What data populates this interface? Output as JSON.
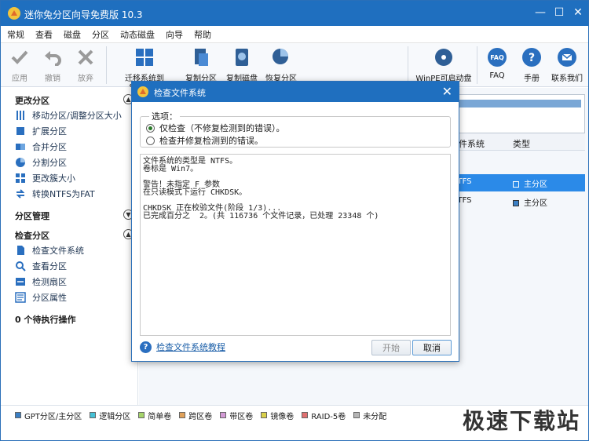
{
  "app": {
    "title": "迷你兔分区向导免费版 10.3"
  },
  "menu": [
    "常规",
    "查看",
    "磁盘",
    "分区",
    "动态磁盘",
    "向导",
    "帮助"
  ],
  "toolbar": {
    "apply": "应用",
    "undo": "撤销",
    "discard": "放弃",
    "migrate": "迁移系统到SSD/HD",
    "copy_partition": "复制分区",
    "copy_disk": "复制磁盘",
    "recover_partition": "恢复分区",
    "winpe": "WinPE可启动盘",
    "faq": "FAQ",
    "manual": "手册",
    "contact": "联系我们"
  },
  "sidebar": {
    "change_partition": "更改分区",
    "change_items": [
      "移动分区/调整分区大小",
      "扩展分区",
      "合并分区",
      "分割分区",
      "更改簇大小",
      "转换NTFS为FAT"
    ],
    "partition_management": "分区管理",
    "check_partition": "检查分区",
    "check_items": [
      "检查文件系统",
      "查看分区",
      "检测扇区",
      "分区属性"
    ],
    "pending": "0 个待执行操作"
  },
  "table": {
    "col_fs": "文件系统",
    "col_type": "类型",
    "rows": [
      {
        "fs": "NTFS",
        "type": "主分区",
        "selected": true
      },
      {
        "fs": "NTFS",
        "type": "主分区",
        "selected": false
      }
    ]
  },
  "legend": [
    {
      "label": "GPT分区/主分区",
      "color": "#3b7fc4"
    },
    {
      "label": "逻辑分区",
      "color": "#45c1d6"
    },
    {
      "label": "简单卷",
      "color": "#a5d46a"
    },
    {
      "label": "跨区卷",
      "color": "#e0a15a"
    },
    {
      "label": "带区卷",
      "color": "#d39ad6"
    },
    {
      "label": "镜像卷",
      "color": "#d9d04a"
    },
    {
      "label": "RAID-5卷",
      "color": "#e07070"
    },
    {
      "label": "未分配",
      "color": "#b5b5b5"
    }
  ],
  "watermark": "极速下载站",
  "dialog": {
    "title": "检查文件系统",
    "options_label": "选项：",
    "option1": "仅检查（不修复检测到的错误）。",
    "option2": "检查并修复检测到的错误。",
    "output": "文件系统的类型是 NTFS。\n卷标是 Win7。\n\n警告！未指定 F 参数\n在只读模式下运行 CHKDSK。\n\nCHKDSK 正在校验文件(阶段 1/3)...\n已完成百分之  2。(共 116736 个文件记录，已处理 23348 个)",
    "help": "检查文件系统教程",
    "start": "开始",
    "cancel": "取消"
  }
}
